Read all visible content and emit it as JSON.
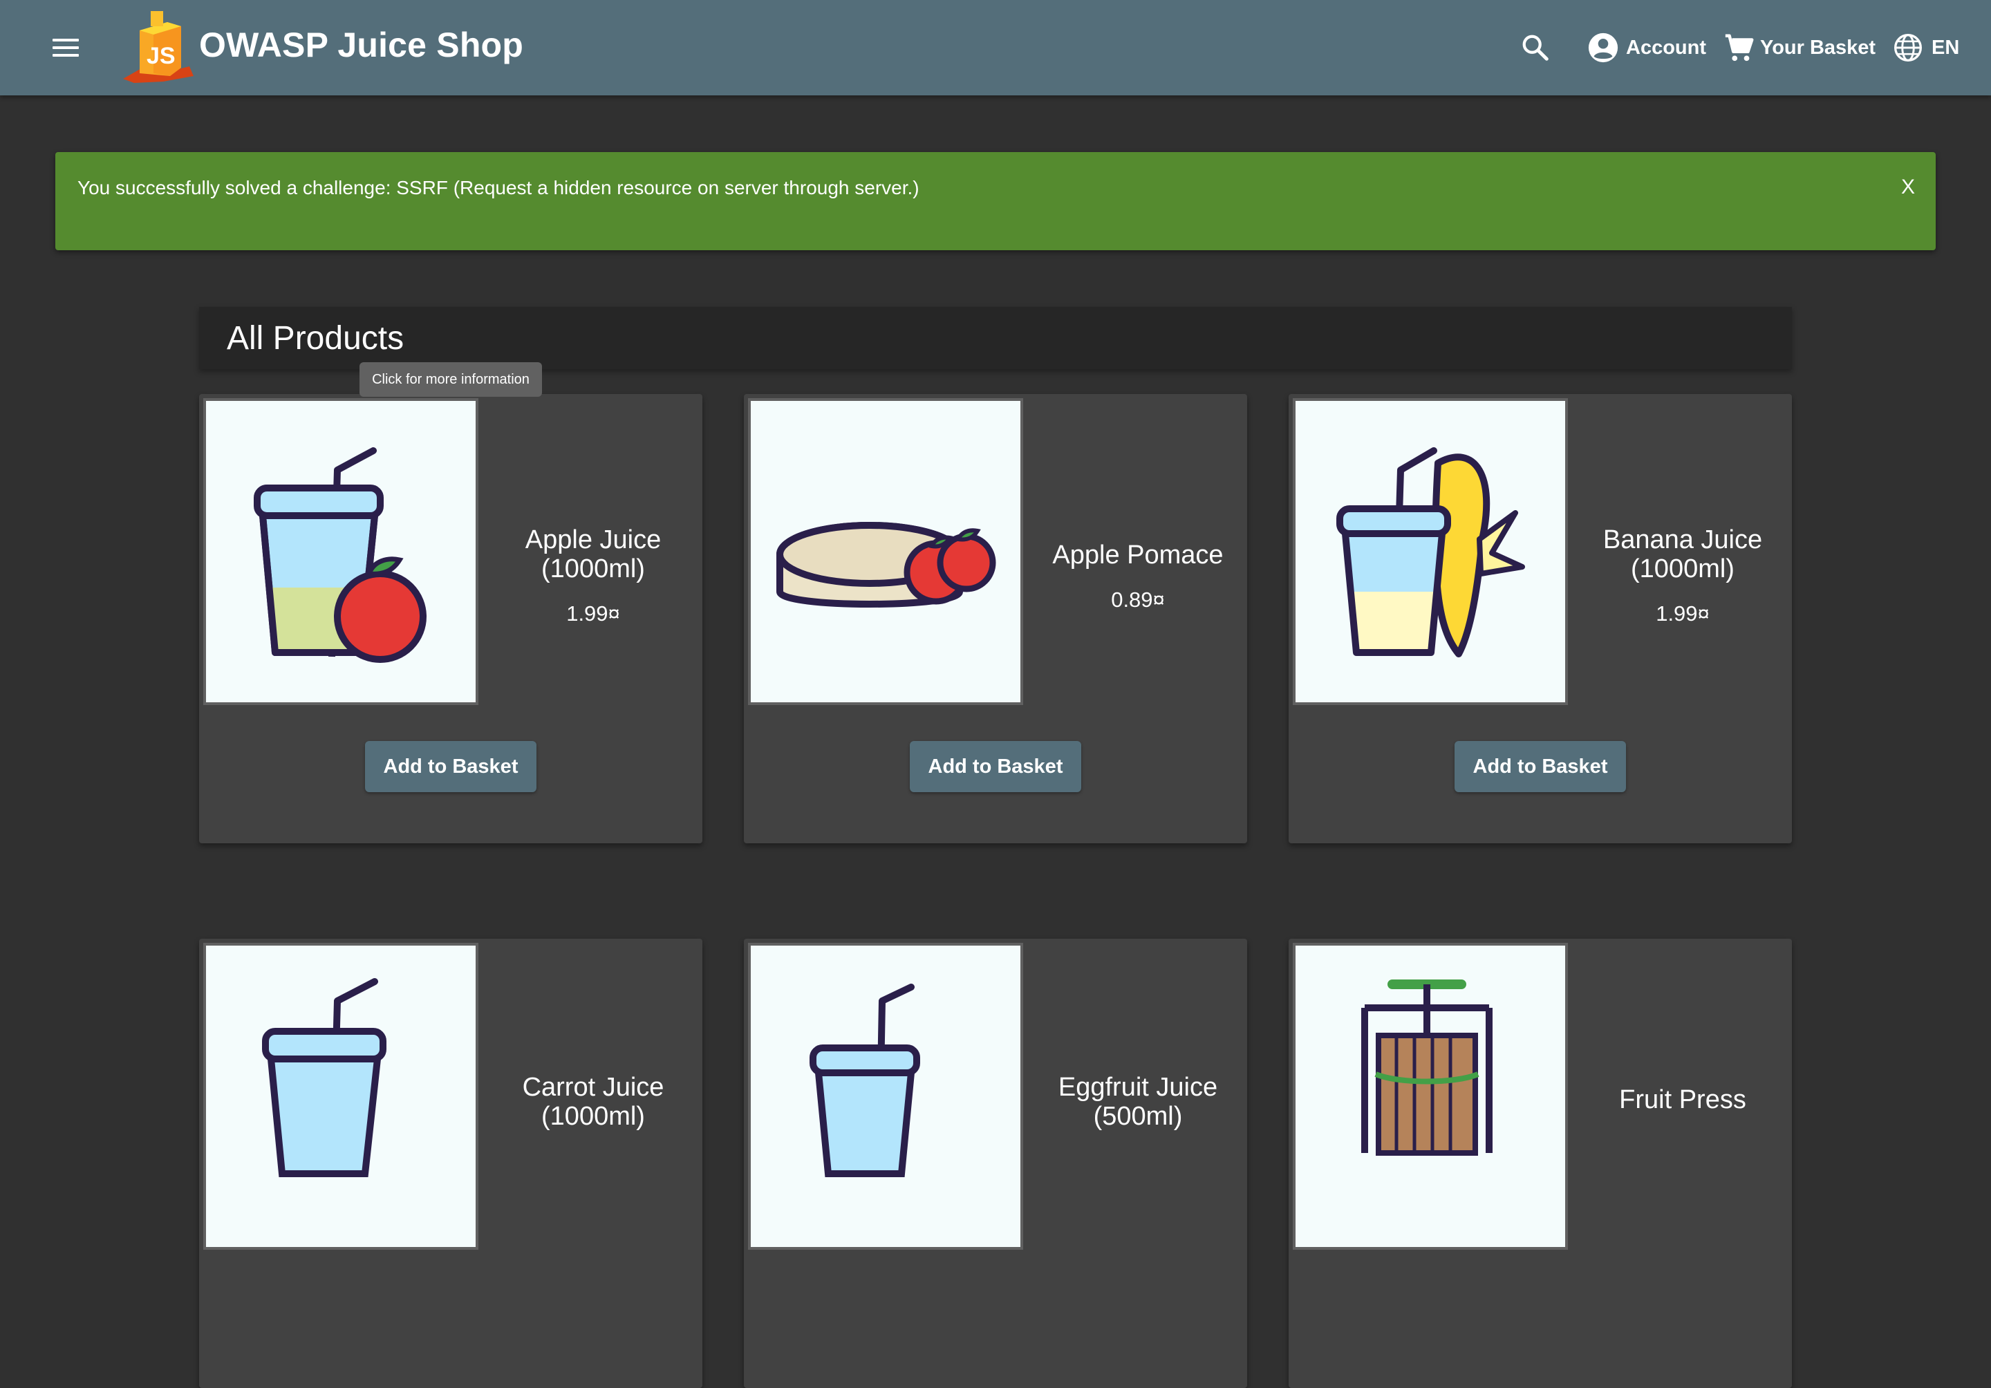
{
  "header": {
    "title": "OWASP Juice Shop",
    "account_label": "Account",
    "basket_label": "Your Basket",
    "language_label": "EN"
  },
  "notification": {
    "message": "You successfully solved a challenge: SSRF (Request a hidden resource on server through server.)",
    "close_label": "X",
    "color": "#558b2f"
  },
  "products_heading": "All Products",
  "tooltip": "Click for more information",
  "products": [
    {
      "name": "Apple Juice (1000ml)",
      "price": "1.99¤",
      "button": "Add to Basket"
    },
    {
      "name": "Apple Pomace",
      "price": "0.89¤",
      "button": "Add to Basket"
    },
    {
      "name": "Banana Juice (1000ml)",
      "price": "1.99¤",
      "button": "Add to Basket"
    },
    {
      "name": "Carrot Juice (1000ml)"
    },
    {
      "name": "Eggfruit Juice (500ml)"
    },
    {
      "name": "Fruit Press"
    }
  ],
  "colors": {
    "toolbar": "#546e7a",
    "background": "#303030",
    "card": "#424242",
    "button": "#546e7a"
  },
  "icons": [
    "menu-icon",
    "search-icon",
    "account-circle-icon",
    "cart-icon",
    "globe-icon"
  ]
}
